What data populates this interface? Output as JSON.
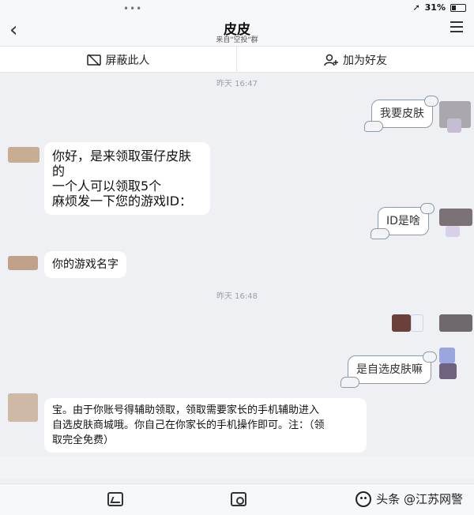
{
  "status": {
    "dots": "•••",
    "battery_text": "31%"
  },
  "nav": {
    "back_icon": "chevron-left-icon",
    "title": "皮皮",
    "subtitle": "来自\"空投\"群",
    "menu_icon": "hamburger-icon"
  },
  "actions": {
    "block_label": "屏蔽此人",
    "block_icon": "block-user-icon",
    "add_friend_label": "加为好友",
    "add_friend_icon": "add-user-icon"
  },
  "messages": {
    "time1": "昨天 16:47",
    "m1": "我要皮肤",
    "m2_line1": "你好，是来领取蛋仔皮肤的",
    "m2_line2": "一个人可以领取5个",
    "m2_line3": "麻烦发一下您的游戏ID：",
    "m3": "ID是啥",
    "m4": "你的游戏名字",
    "time2": "昨天 16:48",
    "m5": "是自选皮肤嘛",
    "m6_line1": "宝。由于你账号得辅助领取，领取需要家长的手机辅助进入",
    "m6_line2": "自选皮肤商城哦。你自己在你家长的手机操作即可。注：（领",
    "m6_line3": "取完全免费）"
  },
  "bottom": {
    "image_icon": "image-icon",
    "camera_icon": "camera-icon",
    "watermark": "头条 @江苏网警"
  },
  "colors": {
    "background": "#eef0f4",
    "bubble": "#ffffff",
    "sticker_border": "#8d9aa6"
  }
}
